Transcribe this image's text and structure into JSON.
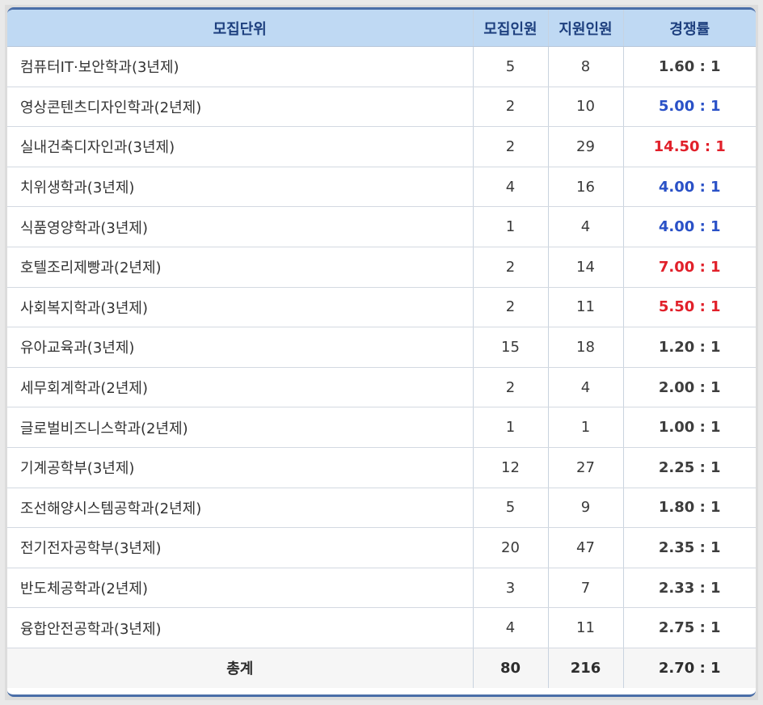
{
  "table": {
    "headers": [
      "모집단위",
      "모집인원",
      "지원인원",
      "경쟁률"
    ],
    "colors": {
      "normal": "#3d3d3d",
      "blue": "#2a51c7",
      "red": "#e1202a"
    },
    "rows": [
      {
        "unit": "컴퓨터IT·보안학과(3년제)",
        "quota": "5",
        "applicants": "8",
        "rate": "1.60 : 1",
        "rate_color": "normal"
      },
      {
        "unit": "영상콘텐츠디자인학과(2년제)",
        "quota": "2",
        "applicants": "10",
        "rate": "5.00 : 1",
        "rate_color": "blue"
      },
      {
        "unit": "실내건축디자인과(3년제)",
        "quota": "2",
        "applicants": "29",
        "rate": "14.50 : 1",
        "rate_color": "red"
      },
      {
        "unit": "치위생학과(3년제)",
        "quota": "4",
        "applicants": "16",
        "rate": "4.00 : 1",
        "rate_color": "blue"
      },
      {
        "unit": "식품영양학과(3년제)",
        "quota": "1",
        "applicants": "4",
        "rate": "4.00 : 1",
        "rate_color": "blue"
      },
      {
        "unit": "호텔조리제빵과(2년제)",
        "quota": "2",
        "applicants": "14",
        "rate": "7.00 : 1",
        "rate_color": "red"
      },
      {
        "unit": "사회복지학과(3년제)",
        "quota": "2",
        "applicants": "11",
        "rate": "5.50 : 1",
        "rate_color": "red"
      },
      {
        "unit": "유아교육과(3년제)",
        "quota": "15",
        "applicants": "18",
        "rate": "1.20 : 1",
        "rate_color": "normal"
      },
      {
        "unit": "세무회계학과(2년제)",
        "quota": "2",
        "applicants": "4",
        "rate": "2.00 : 1",
        "rate_color": "normal"
      },
      {
        "unit": "글로벌비즈니스학과(2년제)",
        "quota": "1",
        "applicants": "1",
        "rate": "1.00 : 1",
        "rate_color": "normal"
      },
      {
        "unit": "기계공학부(3년제)",
        "quota": "12",
        "applicants": "27",
        "rate": "2.25 : 1",
        "rate_color": "normal"
      },
      {
        "unit": "조선해양시스템공학과(2년제)",
        "quota": "5",
        "applicants": "9",
        "rate": "1.80 : 1",
        "rate_color": "normal"
      },
      {
        "unit": "전기전자공학부(3년제)",
        "quota": "20",
        "applicants": "47",
        "rate": "2.35 : 1",
        "rate_color": "normal"
      },
      {
        "unit": "반도체공학과(2년제)",
        "quota": "3",
        "applicants": "7",
        "rate": "2.33 : 1",
        "rate_color": "normal"
      },
      {
        "unit": "융합안전공학과(3년제)",
        "quota": "4",
        "applicants": "11",
        "rate": "2.75 : 1",
        "rate_color": "normal"
      }
    ],
    "total": {
      "label": "총계",
      "quota": "80",
      "applicants": "216",
      "rate": "2.70 : 1"
    }
  }
}
